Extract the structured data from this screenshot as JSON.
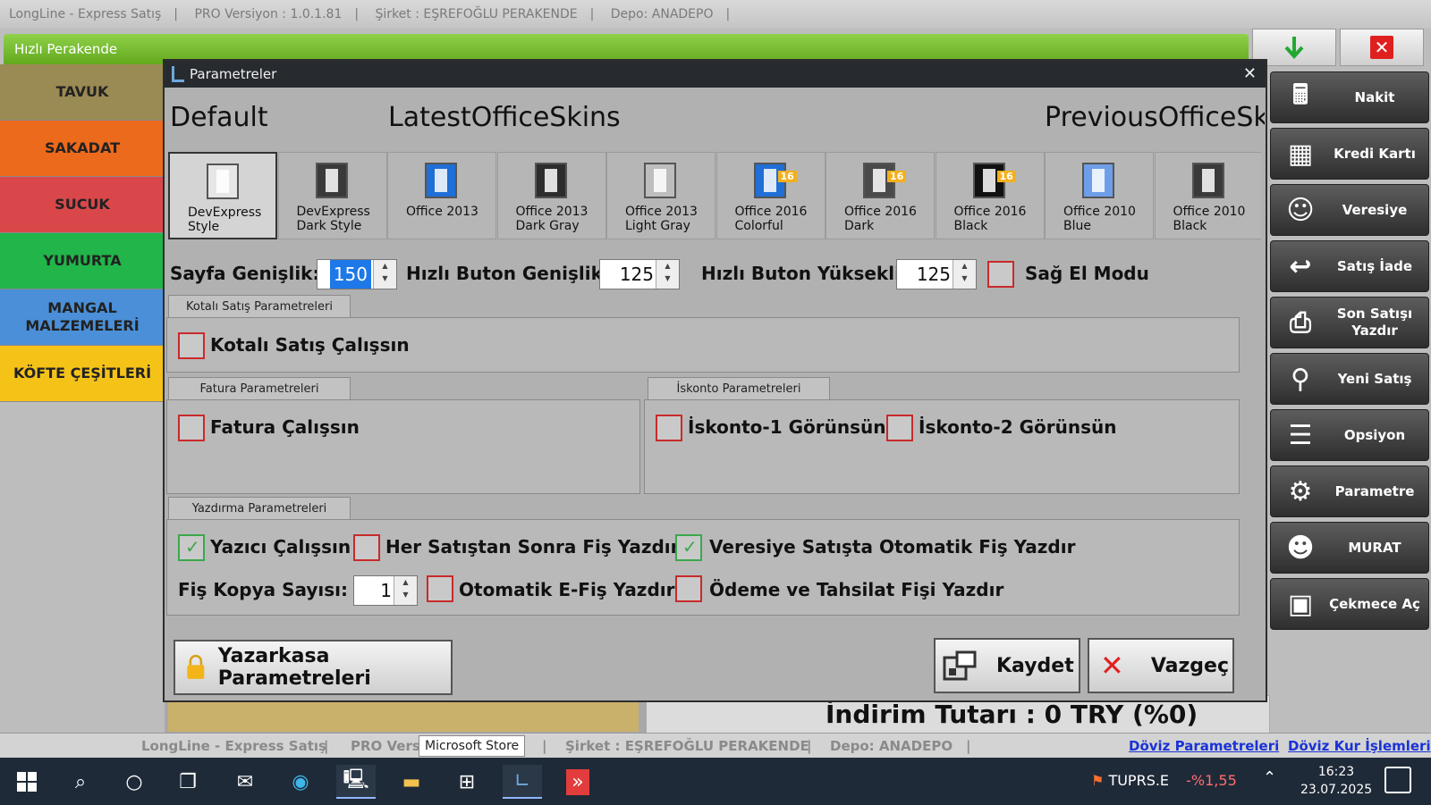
{
  "top_title": {
    "app": "LongLine - Express Satış",
    "version": "PRO Versiyon :  1.0.1.81",
    "company": "Şirket :  EŞREFOĞLU PERAKENDE",
    "depot": "Depo:  ANADEPO"
  },
  "header": {
    "label": "Hızlı Perakende"
  },
  "categories": [
    {
      "label": "TAVUK",
      "color": "#9a8a53"
    },
    {
      "label": "SAKADAT",
      "color": "#ec6a1c"
    },
    {
      "label": "SUCUK",
      "color": "#d9474a"
    },
    {
      "label": "YUMURTA",
      "color": "#21b54a"
    },
    {
      "label": "MANGAL MALZEMELERİ",
      "color": "#4a8fd8"
    },
    {
      "label": "KÖFTE ÇEŞİTLERİ",
      "color": "#f5c218"
    }
  ],
  "right_panel": [
    {
      "label": "Nakit",
      "icon": "cash-register-icon"
    },
    {
      "label": "Kredi Kartı",
      "icon": "card-terminal-icon"
    },
    {
      "label": "Veresiye",
      "icon": "person-credit-icon"
    },
    {
      "label": "Satış İade",
      "icon": "return-icon"
    },
    {
      "label": "Son Satışı Yazdır",
      "icon": "printer-icon"
    },
    {
      "label": "Yeni Satış",
      "icon": "scanner-icon"
    },
    {
      "label": "Opsiyon",
      "icon": "options-icon"
    },
    {
      "label": "Parametre",
      "icon": "user-gear-icon"
    },
    {
      "label": "MURAT",
      "icon": "user-avatar-icon"
    },
    {
      "label": "Çekmece Aç",
      "icon": "drawer-icon"
    }
  ],
  "discount_text": "İndirim Tutarı : 0 TRY (%0)",
  "status": {
    "app": "LongLine - Express Satış",
    "version": "PRO Versi",
    "company": "Şirket :  EŞREFOĞLU PERAKENDE",
    "depot": "Depo:  ANADEPO",
    "link1": "Döviz Parametreleri",
    "link2": "Döviz Kur İşlemleri",
    "tooltip": "Microsoft Store"
  },
  "dialog": {
    "title": "Parametreler",
    "groups": [
      "Default",
      "LatestOfficeSkins",
      "PreviousOfficeSki"
    ],
    "skins": [
      {
        "line1": "DevExpress",
        "line2": "Style",
        "selected": true,
        "color": "#e6e6e6"
      },
      {
        "line1": "DevExpress",
        "line2": "Dark Style",
        "selected": false,
        "color": "#3a3a3a"
      },
      {
        "line1": "Office 2013",
        "line2": "",
        "selected": false,
        "color": "#1f6fd6"
      },
      {
        "line1": "Office 2013",
        "line2": "Dark Gray",
        "selected": false,
        "color": "#2d2d2d"
      },
      {
        "line1": "Office 2013",
        "line2": "Light Gray",
        "selected": false,
        "color": "#bdbdbd"
      },
      {
        "line1": "Office 2016",
        "line2": "Colorful",
        "selected": false,
        "color": "#1f6fd6"
      },
      {
        "line1": "Office 2016",
        "line2": "Dark",
        "selected": false,
        "color": "#4a4a4a"
      },
      {
        "line1": "Office 2016",
        "line2": "Black",
        "selected": false,
        "color": "#111111"
      },
      {
        "line1": "Office 2010",
        "line2": "Blue",
        "selected": false,
        "color": "#6f9ee8"
      },
      {
        "line1": "Office 2010",
        "line2": "Black",
        "selected": false,
        "color": "#3a3a3a"
      }
    ],
    "skin_badge": "16",
    "page_width_label": "Sayfa Genişlik:",
    "page_width_value": "150",
    "quick_btn_width_label": "Hızlı Buton Genişlik:",
    "quick_btn_width_value": "125",
    "quick_btn_height_label": "Hızlı Buton Yükseklik:",
    "quick_btn_height_value": "125",
    "right_hand_label": "Sağ El Modu",
    "quota_tab": "Kotalı Satış Parametreleri",
    "quota_check": "Kotalı Satış Çalışsın",
    "invoice_tab": "Fatura Parametreleri",
    "invoice_check": "Fatura Çalışsın",
    "discount_tab": "İskonto Parametreleri",
    "discount1_check": "İskonto-1 Görünsün",
    "discount2_check": "İskonto-2 Görünsün",
    "print_tab": "Yazdırma Parametreleri",
    "printer_check": "Yazıcı Çalışsın",
    "after_sale_check": "Her Satıştan Sonra Fiş Yazdır",
    "credit_auto_check": "Veresiye Satışta Otomatik Fiş Yazdır",
    "copy_label": "Fiş Kopya Sayısı:",
    "copy_value": "1",
    "auto_efis_check": "Otomatik E-Fiş Yazdır",
    "payment_check": "Ödeme ve Tahsilat Fişi Yazdır",
    "cash_register_btn": "Yazarkasa Parametreleri",
    "save_btn": "Kaydet",
    "cancel_btn": "Vazgeç"
  },
  "taskbar": {
    "ticker_name": "TUPRS.E",
    "ticker_change": "-%1,55",
    "time": "16:23",
    "date": "23.07.2025"
  }
}
